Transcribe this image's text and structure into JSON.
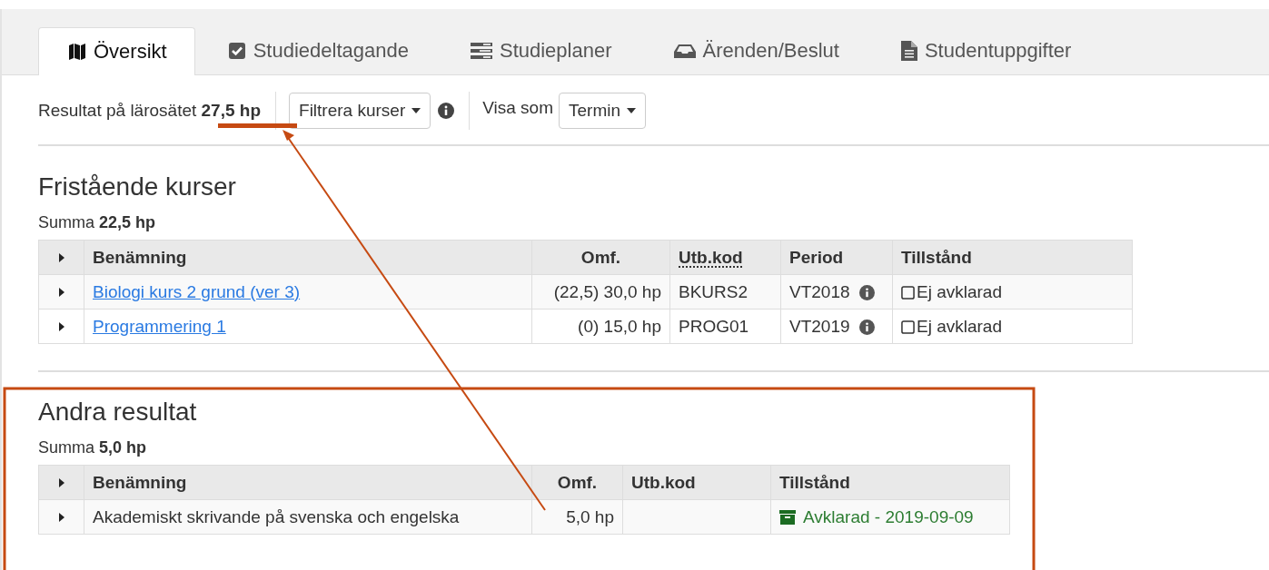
{
  "tabs": [
    {
      "label": "Översikt",
      "selected": true
    },
    {
      "label": "Studiedeltagande",
      "selected": false
    },
    {
      "label": "Studieplaner",
      "selected": false
    },
    {
      "label": "Ärenden/Beslut",
      "selected": false
    },
    {
      "label": "Studentuppgifter",
      "selected": false
    }
  ],
  "toolbar": {
    "result_label": "Resultat på lärosätet",
    "result_value": "27,5 hp",
    "filter_button": "Filtrera kurser",
    "view_label": "Visa som",
    "view_button": "Termin"
  },
  "sections": [
    {
      "title": "Fristående kurser",
      "sum_label": "Summa",
      "sum_value": "22,5 hp",
      "columns": [
        {
          "label": "Benämning",
          "kind": "name",
          "abbr": false
        },
        {
          "label": "Omf.",
          "kind": "scope",
          "abbr": false
        },
        {
          "label": "Utb.kod",
          "kind": "code",
          "abbr": true
        },
        {
          "label": "Period",
          "kind": "period",
          "abbr": false
        },
        {
          "label": "Tillstånd",
          "kind": "status",
          "abbr": false
        }
      ],
      "rows": [
        {
          "name": "Biologi kurs 2 grund (ver 3)",
          "linked": true,
          "scope": "(22,5) 30,0 hp",
          "code": "BKURS2",
          "period": "VT2018",
          "status": "Ej avklarad",
          "kind": "pending"
        },
        {
          "name": "Programmering 1",
          "linked": true,
          "scope": "(0) 15,0 hp",
          "code": "PROG01",
          "period": "VT2019",
          "status": "Ej avklarad",
          "kind": "pending"
        }
      ]
    },
    {
      "title": "Andra resultat",
      "sum_label": "Summa",
      "sum_value": "5,0 hp",
      "columns": [
        {
          "label": "Benämning",
          "kind": "name",
          "abbr": false
        },
        {
          "label": "Omf.",
          "kind": "scope",
          "abbr": false
        },
        {
          "label": "Utb.kod",
          "kind": "code",
          "abbr": false
        },
        {
          "label": "Tillstånd",
          "kind": "status",
          "abbr": false
        }
      ],
      "rows": [
        {
          "name": "Akademiskt skrivande på svenska och engelska",
          "linked": false,
          "scope": "5,0 hp",
          "status": "Avklarad - 2019-09-09",
          "kind": "done"
        }
      ]
    }
  ]
}
